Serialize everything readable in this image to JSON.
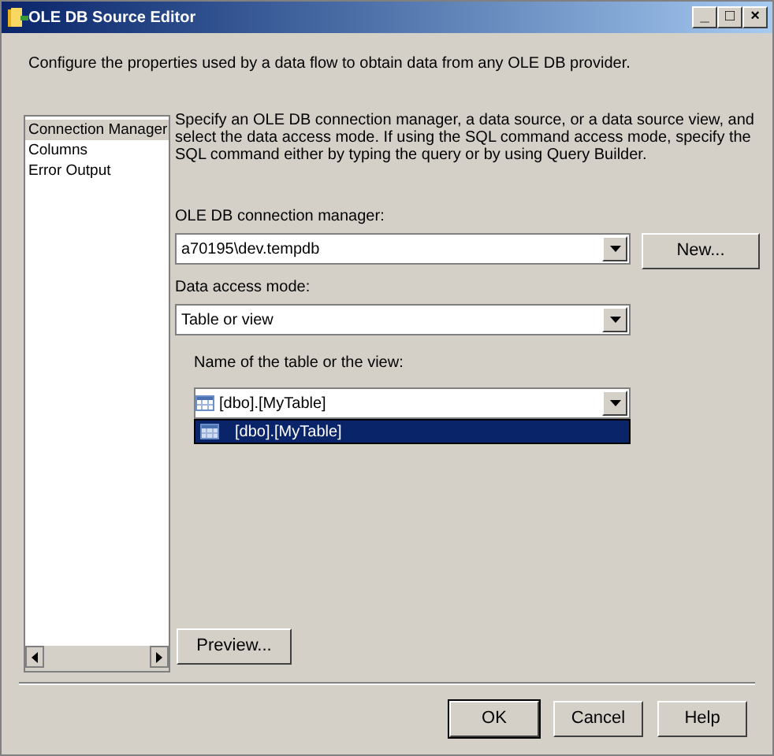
{
  "window": {
    "title": "OLE DB Source Editor",
    "controls": [
      "_",
      "□",
      "×"
    ]
  },
  "description": "Configure the properties used by a data flow to obtain data from any OLE DB provider.",
  "sidebar": {
    "items": [
      {
        "label": "Connection Manager",
        "selected": true
      },
      {
        "label": "Columns",
        "selected": false
      },
      {
        "label": "Error Output",
        "selected": false
      }
    ]
  },
  "instructions": "Specify an OLE DB connection manager, a data source, or a data source view, and select the data access mode. If using the SQL command access mode, specify the SQL command either by typing the query or by using Query Builder.",
  "connection_manager": {
    "label": "OLE DB connection manager:",
    "value": "a70195\\dev.tempdb",
    "button": "New..."
  },
  "access_mode": {
    "label": "Data access mode:",
    "value": "Table or view"
  },
  "table": {
    "label": "Name of the table or the view:",
    "value": "[dbo].[MyTable]",
    "options": [
      {
        "label": "[dbo].[MyTable]",
        "selected": true
      }
    ]
  },
  "preview_button": "Preview...",
  "buttons": [
    "OK",
    "Cancel",
    "Help"
  ]
}
